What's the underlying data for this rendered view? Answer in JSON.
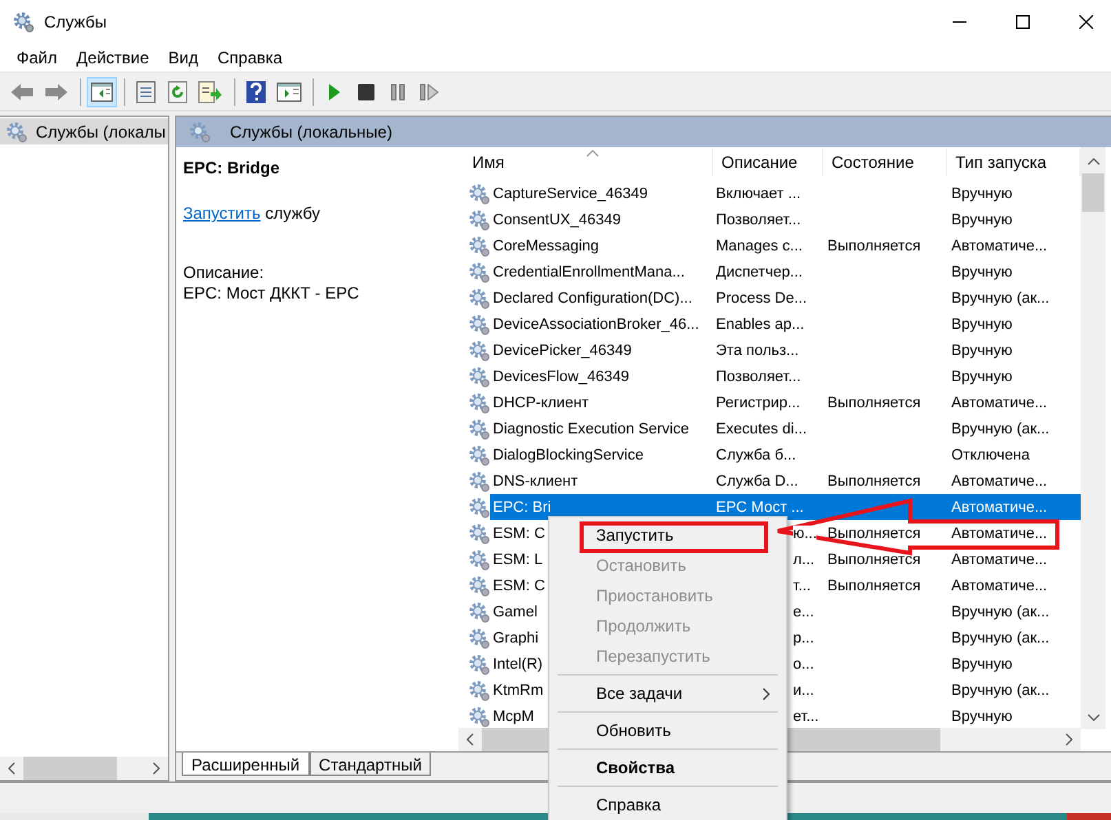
{
  "window": {
    "title": "Службы"
  },
  "menu": [
    "Файл",
    "Действие",
    "Вид",
    "Справка"
  ],
  "toolbar": [
    [
      {
        "kind": "back",
        "selected": false
      },
      {
        "kind": "forward",
        "selected": false
      }
    ],
    [
      {
        "kind": "tree",
        "selected": true
      }
    ],
    [
      {
        "kind": "properties",
        "selected": false
      },
      {
        "kind": "refresh",
        "selected": false
      },
      {
        "kind": "export",
        "selected": false
      }
    ],
    [
      {
        "kind": "help",
        "selected": false
      },
      {
        "kind": "console",
        "selected": false
      }
    ],
    [
      {
        "kind": "play",
        "selected": false
      },
      {
        "kind": "stop",
        "selected": false
      },
      {
        "kind": "pause",
        "selected": false
      },
      {
        "kind": "resume",
        "selected": false
      }
    ]
  ],
  "tree": {
    "items": [
      {
        "label": "Службы (локалы",
        "selected": true
      }
    ]
  },
  "panel_header": "Службы (локальные)",
  "details": {
    "title": "EPC: Bridge",
    "link": "Запустить",
    "link_suffix": "службу",
    "description_label": "Описание:",
    "description": "EPC: Мост ДККТ - EPC"
  },
  "table": {
    "columns": [
      "Имя",
      "Описание",
      "Состояние",
      "Тип запуска"
    ],
    "rows": [
      {
        "kind": "full",
        "selected": false,
        "name": "CaptureService_46349",
        "description": "Включает ...",
        "startup": "Вручную"
      },
      {
        "kind": "full",
        "selected": false,
        "name": "ConsentUX_46349",
        "description": "Позволяет...",
        "startup": "Вручную"
      },
      {
        "kind": "full",
        "selected": false,
        "name": "CoreMessaging",
        "description": "Manages c...",
        "status": "Выполняется",
        "startup": "Автоматиче..."
      },
      {
        "kind": "full",
        "selected": false,
        "name": "CredentialEnrollmentMana...",
        "description": "Диспетчер...",
        "startup": "Вручную"
      },
      {
        "kind": "full",
        "selected": false,
        "name": "Declared Configuration(DC)...",
        "description": "Process De...",
        "startup": "Вручную (ак..."
      },
      {
        "kind": "full",
        "selected": false,
        "name": "DeviceAssociationBroker_46...",
        "description": "Enables ap...",
        "startup": "Вручную"
      },
      {
        "kind": "full",
        "selected": false,
        "name": "DevicePicker_46349",
        "description": "Эта польз...",
        "startup": "Вручную"
      },
      {
        "kind": "full",
        "selected": false,
        "name": "DevicesFlow_46349",
        "description": "Позволяет...",
        "startup": "Вручную"
      },
      {
        "kind": "full",
        "selected": false,
        "name": "DHCP-клиент",
        "description": "Регистрир...",
        "status": "Выполняется",
        "startup": "Автоматиче..."
      },
      {
        "kind": "full",
        "selected": false,
        "name": "Diagnostic Execution Service",
        "description": "Executes di...",
        "startup": "Вручную (ак..."
      },
      {
        "kind": "full",
        "selected": false,
        "name": "DialogBlockingService",
        "description": "Служба б...",
        "startup": "Отключена"
      },
      {
        "kind": "full",
        "selected": false,
        "name": "DNS-клиент",
        "description": "Служба D...",
        "status": "Выполняется",
        "startup": "Автоматиче..."
      },
      {
        "kind": "full",
        "selected": true,
        "name": "EPC: Bri",
        "description": "EPC Мост ...",
        "startup": "Автоматиче..."
      },
      {
        "kind": "covered",
        "selected": false,
        "name": "ESM: C",
        "description": "ю...",
        "status": "Выполняется",
        "startup": "Автоматиче..."
      },
      {
        "kind": "covered",
        "selected": false,
        "name": "ESM: L",
        "description": "л...",
        "status": "Выполняется",
        "startup": "Автоматиче..."
      },
      {
        "kind": "covered",
        "selected": false,
        "name": "ESM: C",
        "description": "т...",
        "status": "Выполняется",
        "startup": "Автоматиче..."
      },
      {
        "kind": "covered",
        "selected": false,
        "name": "Gamel",
        "description": "е...",
        "startup": "Вручную (ак..."
      },
      {
        "kind": "covered",
        "selected": false,
        "name": "Graphi",
        "description": "р...",
        "startup": "Вручную (ак..."
      },
      {
        "kind": "covered",
        "selected": false,
        "name": "Intel(R)",
        "description": "о...",
        "startup": "Вручную"
      },
      {
        "kind": "covered",
        "selected": false,
        "name": "KtmRm",
        "description": "и...",
        "startup": "Вручную (ак..."
      },
      {
        "kind": "covered",
        "selected": false,
        "name": "McpM",
        "description": "ет...",
        "startup": "Вручную"
      }
    ]
  },
  "view_tabs": [
    {
      "label": "Расширенный",
      "selected": true
    },
    {
      "label": "Стандартный",
      "selected": false
    }
  ],
  "context_menu": {
    "items": [
      {
        "kind": "item",
        "label": "Запустить",
        "disabled": false
      },
      {
        "kind": "item",
        "label": "Остановить",
        "disabled": true
      },
      {
        "kind": "item",
        "label": "Приостановить",
        "disabled": true
      },
      {
        "kind": "item",
        "label": "Продолжить",
        "disabled": true
      },
      {
        "kind": "item",
        "label": "Перезапустить",
        "disabled": true
      },
      {
        "kind": "separator"
      },
      {
        "kind": "submenu",
        "label": "Все задачи",
        "disabled": false
      },
      {
        "kind": "separator"
      },
      {
        "kind": "item",
        "label": "Обновить",
        "disabled": false
      },
      {
        "kind": "separator"
      },
      {
        "kind": "default",
        "label": "Свойства",
        "disabled": false
      },
      {
        "kind": "separator"
      },
      {
        "kind": "item",
        "label": "Справка",
        "disabled": false
      }
    ]
  }
}
